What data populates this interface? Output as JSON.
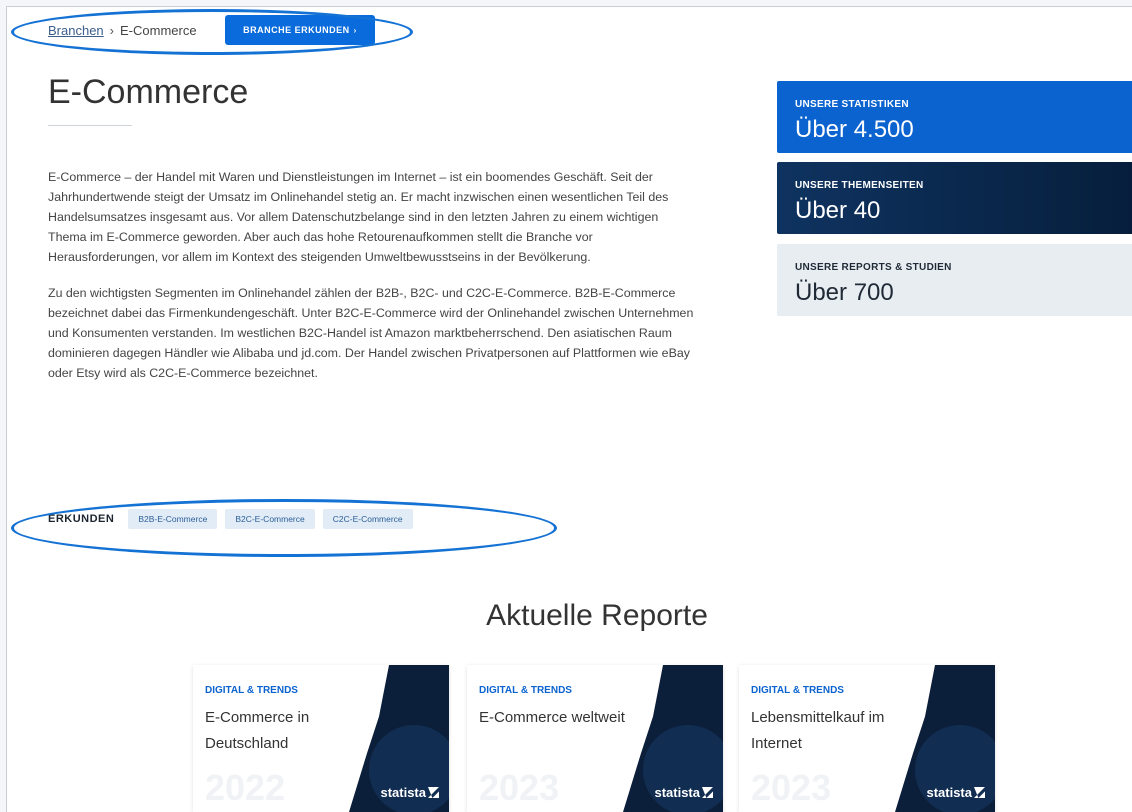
{
  "breadcrumb": {
    "parent": "Branchen",
    "separator": "›",
    "current": "E-Commerce"
  },
  "header_button": {
    "label": "BRANCHE ERKUNDEN",
    "chevron": "›"
  },
  "page_title": "E-Commerce",
  "intro": {
    "paragraph1": "E-Commerce – der Handel mit Waren und Dienstleistungen im Internet – ist ein boomendes Geschäft. Seit der Jahrhundertwende steigt der Umsatz im Onlinehandel stetig an. Er macht inzwischen einen wesentlichen Teil des Handelsumsatzes insgesamt aus. Vor allem Datenschutzbelange sind in den letzten Jahren zu einem wichtigen Thema im E-Commerce geworden. Aber auch das hohe Retourenaufkommen stellt die Branche vor Herausforderungen, vor allem im Kontext des steigenden Umweltbewusstseins in der Bevölkerung.",
    "paragraph2": "Zu den wichtigsten Segmenten im Onlinehandel zählen der B2B-, B2C- und C2C-E-Commerce. B2B-E-Commerce bezeichnet dabei das Firmenkundengeschäft. Unter B2C-E-Commerce wird der Onlinehandel zwischen Unternehmen und Konsumenten verstanden. Im westlichen B2C-Handel ist Amazon marktbeherrschend. Den asiatischen Raum dominieren dagegen Händler wie Alibaba und jd.com. Der Handel zwischen Privatpersonen auf Plattformen wie eBay oder Etsy wird als C2C-E-Commerce bezeichnet."
  },
  "stats": [
    {
      "label": "UNSERE STATISTIKEN",
      "value": "Über 4.500"
    },
    {
      "label": "UNSERE THEMENSEITEN",
      "value": "Über 40"
    },
    {
      "label": "UNSERE REPORTS & STUDIEN",
      "value": "Über 700"
    }
  ],
  "explore": {
    "label": "ERKUNDEN",
    "chips": [
      "B2B-E-Commerce",
      "B2C-E-Commerce",
      "C2C-E-Commerce"
    ]
  },
  "reports_section": {
    "title": "Aktuelle Reporte",
    "items": [
      {
        "category": "DIGITAL & TRENDS",
        "title": "E-Commerce in Deutschland",
        "year": "2022",
        "brand": "statista"
      },
      {
        "category": "DIGITAL & TRENDS",
        "title": "E-Commerce weltweit",
        "year": "2023",
        "brand": "statista"
      },
      {
        "category": "DIGITAL & TRENDS",
        "title": "Lebensmittelkauf im Internet",
        "year": "2023",
        "brand": "statista"
      }
    ]
  },
  "colors": {
    "accent_blue": "#0b63cf",
    "navy": "#0f3360",
    "annotation_circle": "#1472d4",
    "chip_bg": "#e2ecf6"
  }
}
